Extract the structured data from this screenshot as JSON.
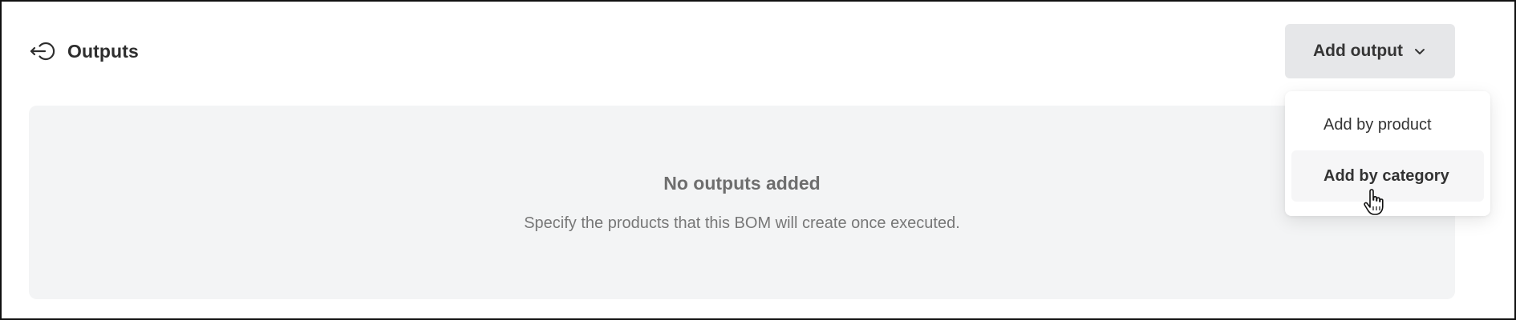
{
  "section": {
    "title": "Outputs",
    "icon": "output-arrow-icon"
  },
  "add_output": {
    "label": "Add output",
    "icon": "chevron-down-icon"
  },
  "dropdown": {
    "items": [
      {
        "label": "Add by product",
        "state": "default"
      },
      {
        "label": "Add by category",
        "state": "hovered"
      }
    ]
  },
  "empty_state": {
    "title": "No outputs added",
    "description": "Specify the products that this BOM will create once executed."
  },
  "colors": {
    "button_bg": "#e6e7e9",
    "panel_bg": "#f3f4f5",
    "text_primary": "#2e2e2e",
    "text_muted": "#777777"
  }
}
